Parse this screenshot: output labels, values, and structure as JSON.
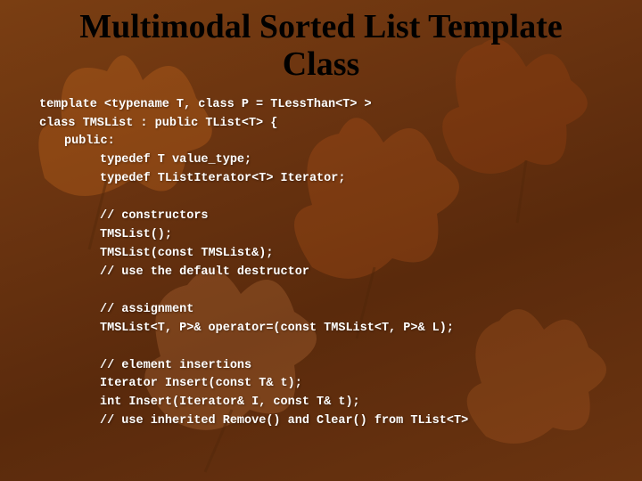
{
  "title_line1": "Multimodal Sorted List Template",
  "title_line2": "Class",
  "code": {
    "l01": "template <typename T, class P = TLessThan<T> >",
    "l02": "class TMSList : public TList<T> {",
    "l03": "public:",
    "l04": "typedef T value_type;",
    "l05": "typedef TListIterator<T> Iterator;",
    "l06": "// constructors",
    "l07": "TMSList();",
    "l08": "TMSList(const TMSList&);",
    "l09": "// use the default destructor",
    "l10": "// assignment",
    "l11": "TMSList<T, P>& operator=(const TMSList<T, P>& L);",
    "l12": "// element insertions",
    "l13": "Iterator Insert(const T& t);",
    "l14": "int Insert(Iterator& I, const T& t);",
    "l15": "// use inherited Remove() and Clear() from TList<T>"
  }
}
